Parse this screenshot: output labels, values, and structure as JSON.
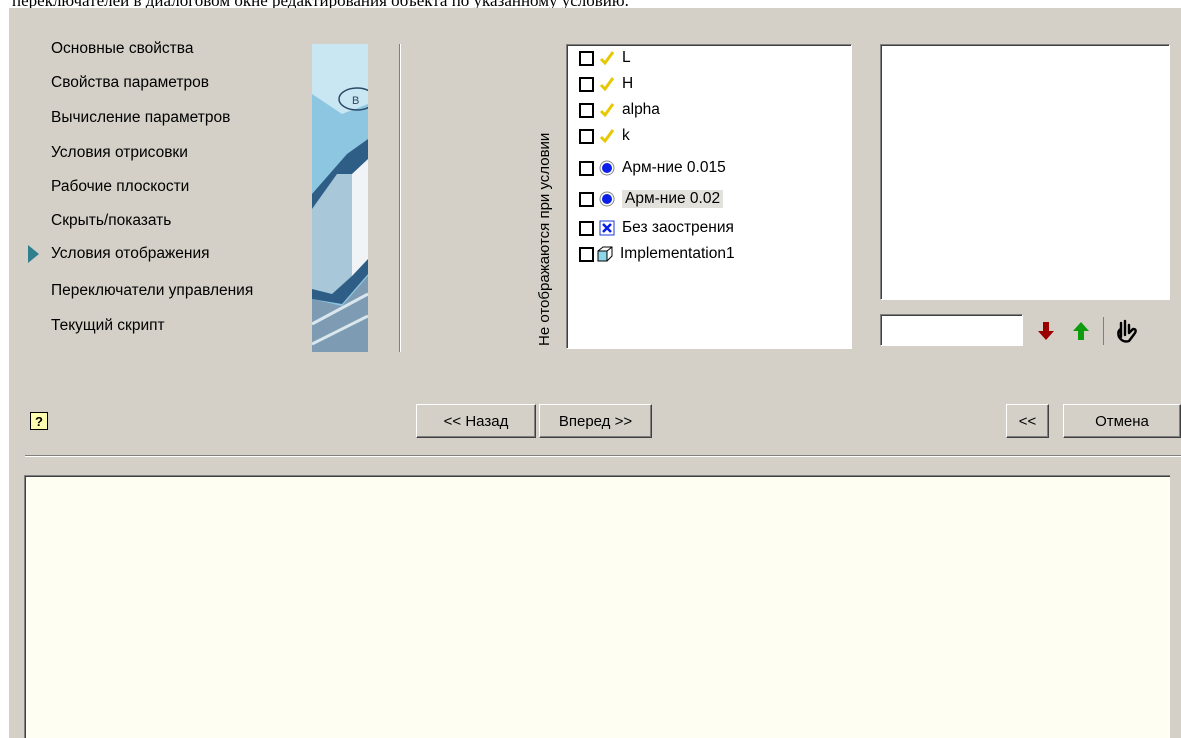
{
  "top_caption": "переключателей в диалоговом окне редактирования объекта по указанному условию.",
  "nav": {
    "items": [
      {
        "label": "Основные свойства"
      },
      {
        "label": "Свойства параметров"
      },
      {
        "label": "Вычисление параметров"
      },
      {
        "label": "Условия отрисовки"
      },
      {
        "label": "Рабочие плоскости"
      },
      {
        "label": "Скрыть/показать"
      },
      {
        "label": "Условия отображения",
        "active": true
      },
      {
        "label": "Переключатели управления"
      },
      {
        "label": "Текущий скрипт"
      }
    ]
  },
  "hidden_list": {
    "vertical_label": "Не отображаются при условии",
    "items": [
      {
        "label": "L",
        "icon": "yellow-check-icon",
        "checked": false
      },
      {
        "label": "H",
        "icon": "yellow-check-icon",
        "checked": false
      },
      {
        "label": "alpha",
        "icon": "yellow-check-icon",
        "checked": false
      },
      {
        "label": "k",
        "icon": "yellow-check-icon",
        "checked": false
      },
      {
        "label": "Арм-ние 0.015",
        "icon": "radio-icon",
        "checked": false
      },
      {
        "label": "Арм-ние 0.02",
        "icon": "radio-icon",
        "checked": false,
        "selected": true
      },
      {
        "label": "Без заострения",
        "icon": "checkbox-x-icon",
        "checked": false
      },
      {
        "label": "Implementation1",
        "icon": "cube-icon",
        "checked": false
      }
    ]
  },
  "condition": {
    "input_value": ""
  },
  "buttons": {
    "back": "<< Назад",
    "next": "Вперед >>",
    "collapse": "<<",
    "cancel": "Отмена"
  },
  "colors": {
    "dialog_bg": "#d4d0c8",
    "accent": "#2f7f8f",
    "description_bg": "#fefef2"
  }
}
